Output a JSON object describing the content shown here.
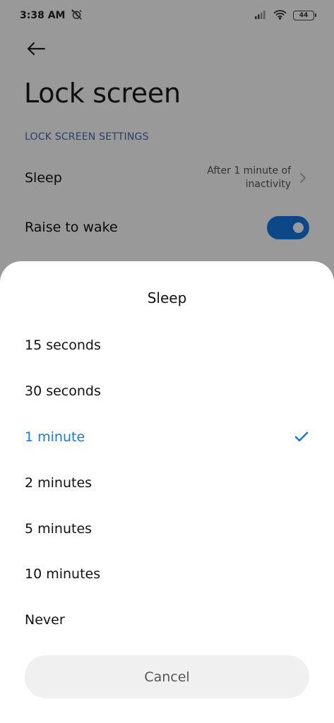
{
  "status_bar": {
    "time": "3:38 AM",
    "battery": "44",
    "icons": [
      "alarm-off-icon",
      "signal-icon",
      "wifi-icon",
      "battery-icon"
    ]
  },
  "page": {
    "title": "Lock screen",
    "section_header": "LOCK SCREEN SETTINGS",
    "sleep_label": "Sleep",
    "sleep_value": "After 1 minute of inactivity",
    "raise_label": "Raise to wake",
    "raise_enabled": true
  },
  "sheet": {
    "title": "Sleep",
    "options": [
      {
        "label": "15 seconds",
        "selected": false
      },
      {
        "label": "30 seconds",
        "selected": false
      },
      {
        "label": "1 minute",
        "selected": true
      },
      {
        "label": "2 minutes",
        "selected": false
      },
      {
        "label": "5 minutes",
        "selected": false
      },
      {
        "label": "10 minutes",
        "selected": false
      },
      {
        "label": "Never",
        "selected": false
      }
    ],
    "cancel_label": "Cancel"
  },
  "colors": {
    "accent": "#1479e3",
    "section_header": "#4b6aa8",
    "scrim": "rgba(0,0,0,0.40)"
  }
}
